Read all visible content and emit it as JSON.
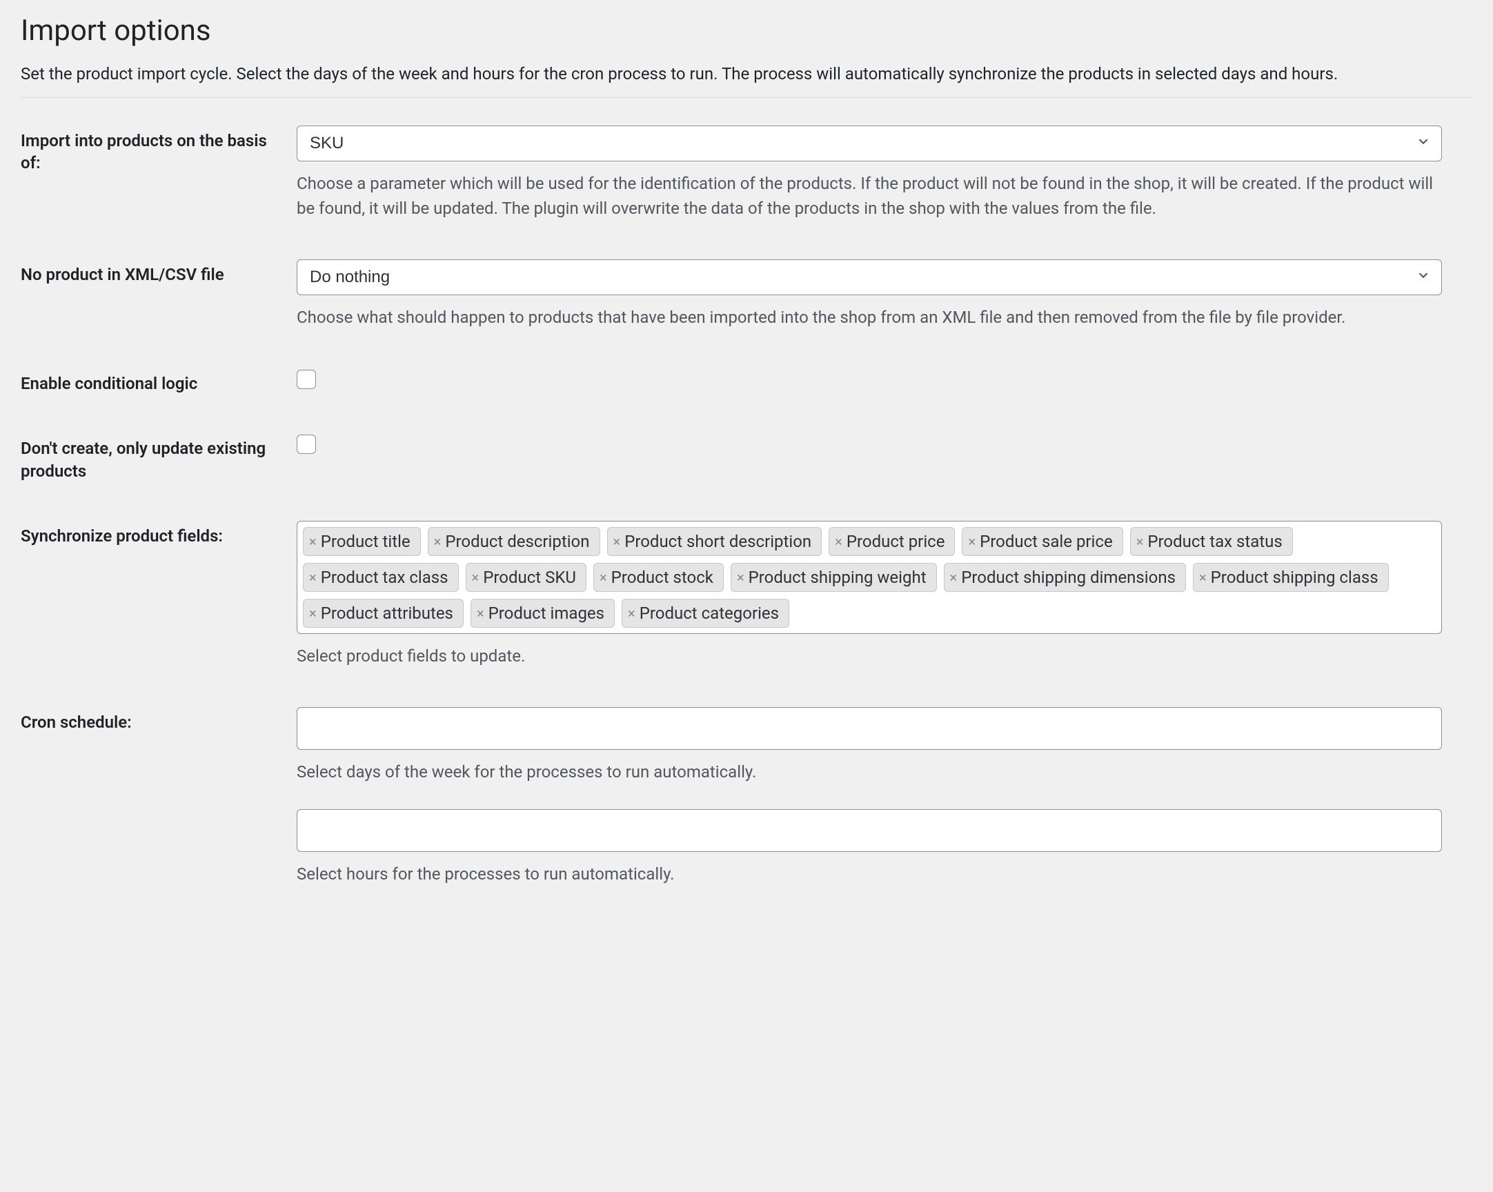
{
  "heading": "Import options",
  "section_description": "Set the product import cycle. Select the days of the week and hours for the cron process to run. The process will automatically synchronize the products in selected days and hours.",
  "rows": {
    "import_basis": {
      "label": "Import into products on the basis of:",
      "value": "SKU",
      "help": "Choose a parameter which will be used for the identification of the products. If the product will not be found in the shop, it will be created. If the product will be found, it will be updated. The plugin will overwrite the data of the products in the shop with the values from the file."
    },
    "no_product": {
      "label": "No product in XML/CSV file",
      "value": "Do nothing",
      "help": "Choose what should happen to products that have been imported into the shop from an XML file and then removed from the file by file provider."
    },
    "conditional_logic": {
      "label": "Enable conditional logic"
    },
    "only_update": {
      "label": "Don't create, only update existing products"
    },
    "sync_fields": {
      "label": "Synchronize product fields:",
      "help": "Select product fields to update.",
      "tags": [
        "Product title",
        "Product description",
        "Product short description",
        "Product price",
        "Product sale price",
        "Product tax status",
        "Product tax class",
        "Product SKU",
        "Product stock",
        "Product shipping weight",
        "Product shipping dimensions",
        "Product shipping class",
        "Product attributes",
        "Product images",
        "Product categories"
      ]
    },
    "cron_schedule": {
      "label": "Cron schedule:",
      "help_days": "Select days of the week for the processes to run automatically.",
      "help_hours": "Select hours for the processes to run automatically."
    }
  }
}
